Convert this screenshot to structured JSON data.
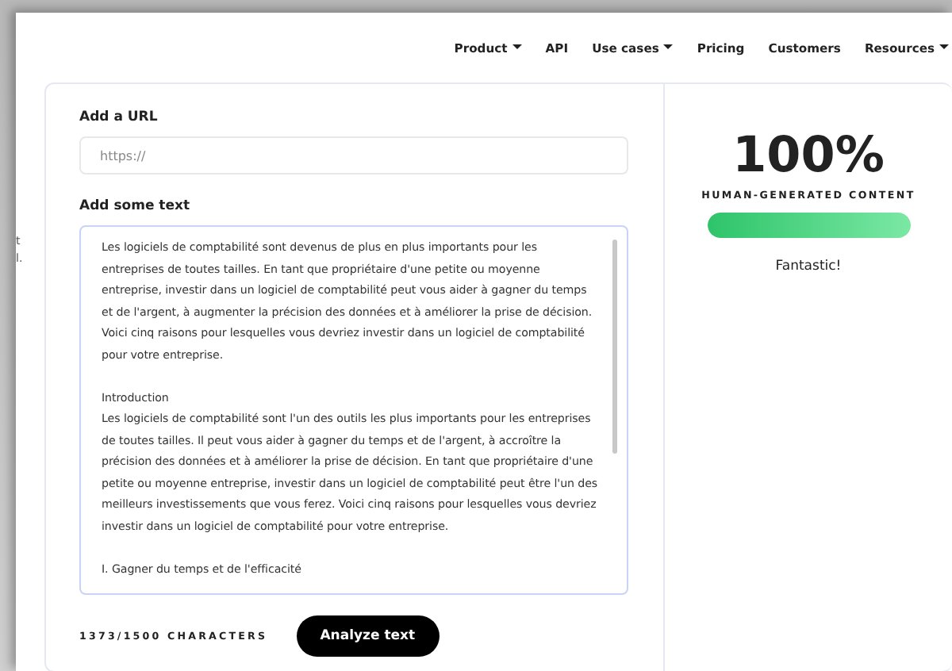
{
  "nav": {
    "items": [
      {
        "label": "Product",
        "dropdown": true
      },
      {
        "label": "API",
        "dropdown": false
      },
      {
        "label": "Use cases",
        "dropdown": true
      },
      {
        "label": "Pricing",
        "dropdown": false
      },
      {
        "label": "Customers",
        "dropdown": false
      },
      {
        "label": "Resources",
        "dropdown": true
      }
    ]
  },
  "side_fragments": [
    "t",
    "l."
  ],
  "form": {
    "url_label": "Add a URL",
    "url_placeholder": "https://",
    "text_label": "Add some text",
    "text_value": "Les logiciels de comptabilité sont devenus de plus en plus importants pour les entreprises de toutes tailles. En tant que propriétaire d'une petite ou moyenne entreprise, investir dans un logiciel de comptabilité peut vous aider à gagner du temps et de l'argent, à augmenter la précision des données et à améliorer la prise de décision. Voici cinq raisons pour lesquelles vous devriez investir dans un logiciel de comptabilité pour votre entreprise.\n\nIntroduction\nLes logiciels de comptabilité sont l'un des outils les plus importants pour les entreprises de toutes tailles. Il peut vous aider à gagner du temps et de l'argent, à accroître la précision des données et à améliorer la prise de décision. En tant que propriétaire d'une petite ou moyenne entreprise, investir dans un logiciel de comptabilité peut être l'un des meilleurs investissements que vous ferez. Voici cinq raisons pour lesquelles vous devriez investir dans un logiciel de comptabilité pour votre entreprise.\n\nI. Gagner du temps et de l'efficacité",
    "char_count": "1373/1500 CHARACTERS",
    "button": "Analyze text"
  },
  "result": {
    "score": "100%",
    "label": "HUMAN-GENERATED CONTENT",
    "level": 1,
    "verdict": "Fantastic!"
  }
}
